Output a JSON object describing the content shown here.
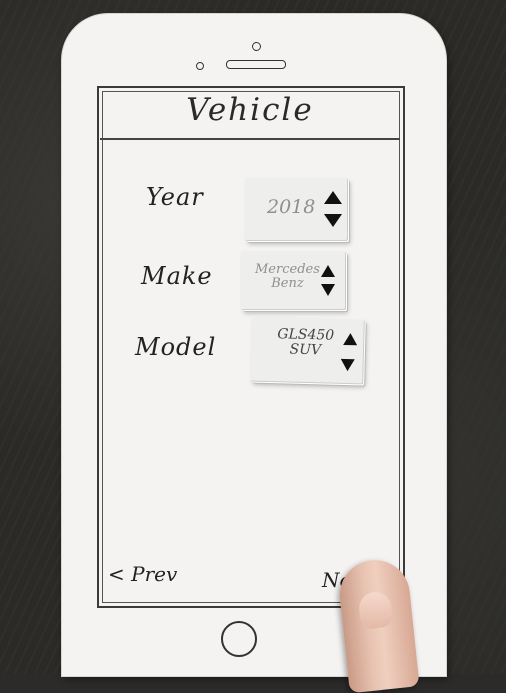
{
  "screen": {
    "title": "Vehicle",
    "fields": [
      {
        "label": "Year",
        "value": "2018"
      },
      {
        "label": "Make",
        "value": "Mercedes\nBenz"
      },
      {
        "label": "Model",
        "value": "GLS450\nSUV"
      }
    ],
    "nav": {
      "prev_label": "< Prev",
      "next_label": "Ne"
    }
  },
  "colors": {
    "paper": "#f4f3f1",
    "background": "#2b2a27",
    "ink": "#222222",
    "picker_text": "#8f8f8f"
  },
  "icons": [
    "chevron-up-icon",
    "chevron-down-icon",
    "home-button-icon",
    "camera-icon",
    "speaker-icon"
  ]
}
